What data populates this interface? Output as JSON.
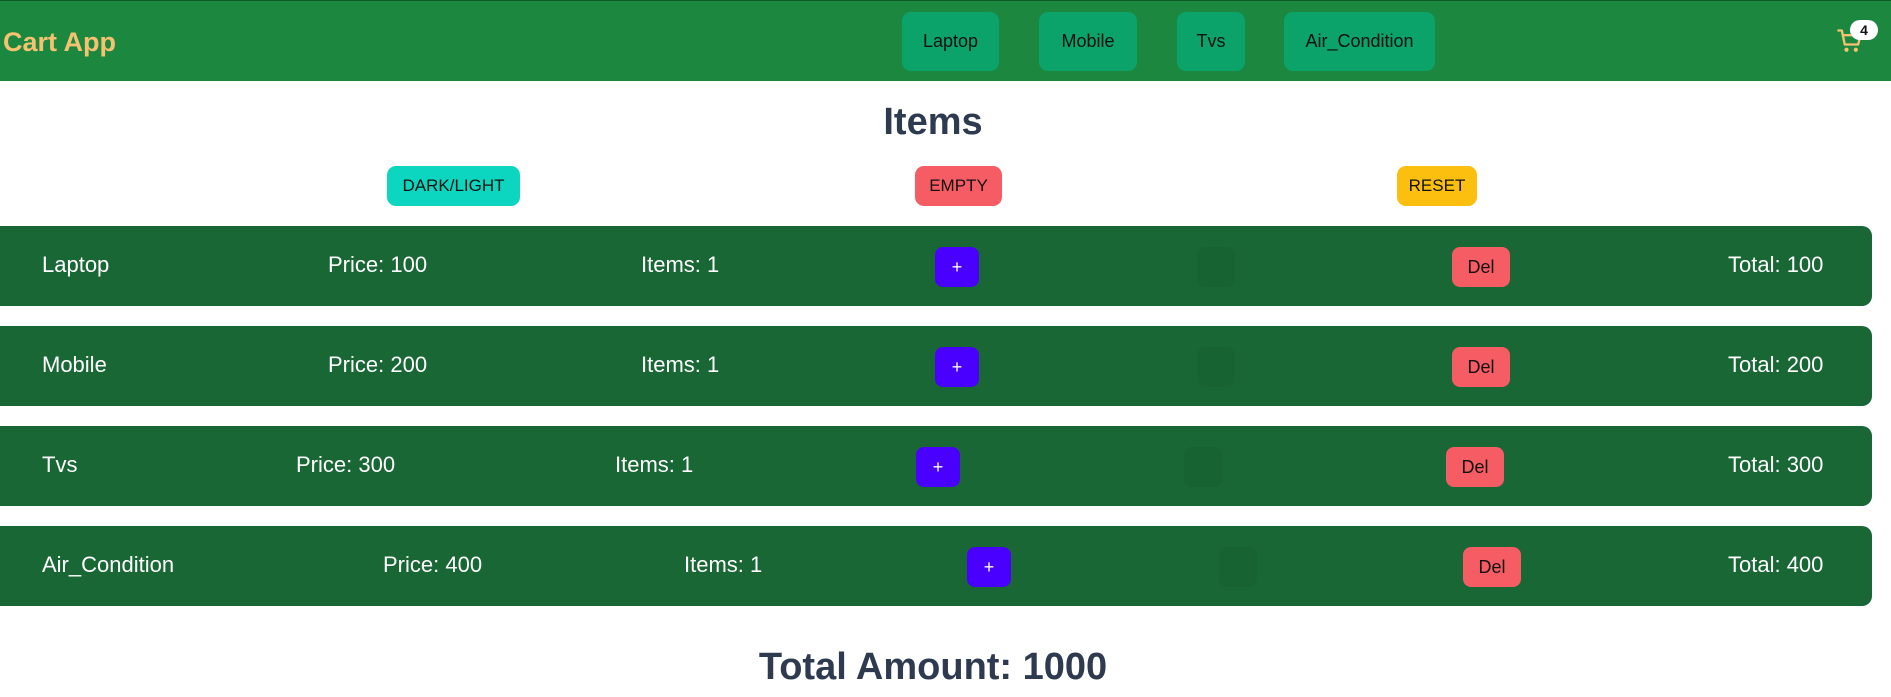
{
  "app": {
    "title": "Cart App"
  },
  "nav": {
    "items": [
      "Laptop",
      "Mobile",
      "Tvs",
      "Air_Condition"
    ]
  },
  "cart": {
    "count": "4"
  },
  "page": {
    "title": "Items"
  },
  "controls": {
    "theme_label": "DARK/LIGHT",
    "empty_label": "EMPTY",
    "reset_label": "RESET"
  },
  "items": [
    {
      "name": "Laptop",
      "price": "Price: 100",
      "count": "Items: 1",
      "plus": "+",
      "del": "Del",
      "total": "Total: 100"
    },
    {
      "name": "Mobile",
      "price": "Price: 200",
      "count": "Items: 1",
      "plus": "+",
      "del": "Del",
      "total": "Total: 200"
    },
    {
      "name": "Tvs",
      "price": "Price: 300",
      "count": "Items: 1",
      "plus": "+",
      "del": "Del",
      "total": "Total: 300"
    },
    {
      "name": "Air_Condition",
      "price": "Price: 400",
      "count": "Items: 1",
      "plus": "+",
      "del": "Del",
      "total": "Total: 400"
    }
  ],
  "summary": {
    "total_amount": "Total Amount: 1000"
  },
  "colors": {
    "navbar": "#1c873e",
    "brand": "#f5c271",
    "nav_button": "#0ba36a",
    "row": "#186734",
    "plus_button": "#4a00ff",
    "delete_button": "#f65c64",
    "theme_button": "#0cd6c0",
    "empty_button": "#f65c64",
    "reset_button": "#fcbf0f",
    "heading": "#2e3a4f"
  }
}
